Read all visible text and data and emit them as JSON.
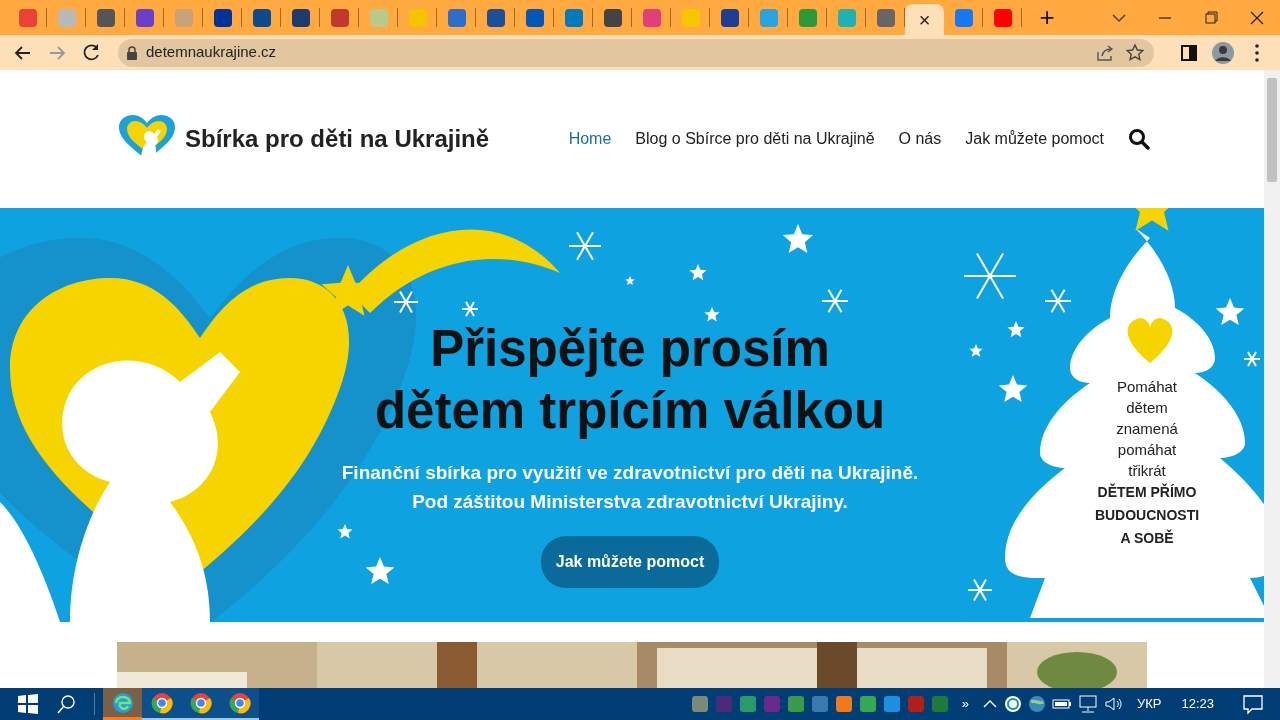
{
  "browser": {
    "tabs": [
      {
        "selected": false,
        "color": "#ea4335"
      },
      {
        "selected": false,
        "color": "#b9b9b9"
      },
      {
        "selected": false,
        "color": "#555555"
      },
      {
        "selected": false,
        "color": "#6b3fc9"
      },
      {
        "selected": false,
        "color": "#c8a27a"
      },
      {
        "selected": false,
        "color": "#003399"
      },
      {
        "selected": false,
        "color": "#0d4c8c"
      },
      {
        "selected": false,
        "color": "#1e3a6e"
      },
      {
        "selected": false,
        "color": "#c0392b"
      },
      {
        "selected": false,
        "color": "#b8c98a"
      },
      {
        "selected": false,
        "color": "#f5c400"
      },
      {
        "selected": false,
        "color": "#2d6ec9"
      },
      {
        "selected": false,
        "color": "#1d4e9a"
      },
      {
        "selected": false,
        "color": "#0057b7"
      },
      {
        "selected": false,
        "color": "#0079bf"
      },
      {
        "selected": false,
        "color": "#444444"
      },
      {
        "selected": false,
        "color": "#e0407a"
      },
      {
        "selected": false,
        "color": "#f7c600"
      },
      {
        "selected": false,
        "color": "#1c3f94"
      },
      {
        "selected": false,
        "color": "#2aa3e0"
      },
      {
        "selected": false,
        "color": "#2c9a3a"
      },
      {
        "selected": false,
        "color": "#1fb2b2"
      },
      {
        "selected": false,
        "color": "#666666"
      },
      {
        "selected": true,
        "close": "×"
      },
      {
        "selected": false,
        "color": "#1877f2"
      },
      {
        "selected": false,
        "color": "#ff0000"
      }
    ],
    "new_tab": "+",
    "back_disabled": false,
    "forward_disabled": true,
    "url": "detemnaukrajine.cz"
  },
  "site": {
    "title": "Sbírka pro děti na Ukrajině",
    "nav": [
      {
        "label": "Home",
        "selected": true
      },
      {
        "label": "Blog o Sbírce pro děti na Ukrajině",
        "selected": false
      },
      {
        "label": "O nás",
        "selected": false
      },
      {
        "label": "Jak můžete pomoct",
        "selected": false
      }
    ]
  },
  "hero": {
    "heading_lines": [
      "Přispějte prosím",
      "dětem trpícím válkou"
    ],
    "subtitle_lines": [
      "Finanční sbírka pro využití ve zdravotnictví pro děti na Ukrajině.",
      "Pod záštitou Ministerstva zdravotnictví Ukrajiny."
    ],
    "button": "Jak můžete pomoct",
    "tree_lines": [
      {
        "text": "Pomáhat",
        "bold": false
      },
      {
        "text": "dětem",
        "bold": false
      },
      {
        "text": "znamená",
        "bold": false
      },
      {
        "text": "pomáhat",
        "bold": false
      },
      {
        "text": "třikrát",
        "bold": false
      },
      {
        "text": "DĚTEM PŘÍMO",
        "bold": true
      },
      {
        "text": "BUDOUCNOSTI",
        "bold": true
      },
      {
        "text": "A SOBĚ",
        "bold": true
      }
    ]
  },
  "taskbar": {
    "pinned": [
      {
        "selected": true,
        "kind": "edge"
      },
      {
        "selected": false,
        "kind": "chrome"
      },
      {
        "selected": false,
        "kind": "chrome"
      },
      {
        "selected": false,
        "kind": "chrome"
      }
    ],
    "tray_apps": [
      {
        "color": "#7a8a7a"
      },
      {
        "color": "#4b2a7a"
      },
      {
        "color": "#2a9a6a"
      },
      {
        "color": "#6a2a8a"
      },
      {
        "color": "#3a9a4a"
      },
      {
        "color": "#3a7ab0"
      },
      {
        "color": "#f07a1a"
      },
      {
        "color": "#34a853"
      },
      {
        "color": "#1e90e0"
      },
      {
        "color": "#b0201a"
      },
      {
        "color": "#1e7a3a"
      }
    ],
    "overflow": "»",
    "language": "УКР",
    "time": "12:23"
  }
}
